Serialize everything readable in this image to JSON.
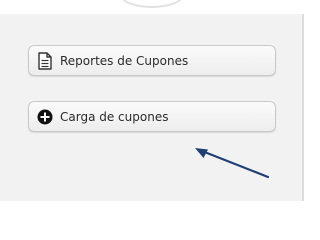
{
  "menu": {
    "items": [
      {
        "label": "Reportes de Cupones",
        "icon": "document-icon"
      },
      {
        "label": "Carga de cupones",
        "icon": "plus-circle-icon"
      }
    ]
  },
  "colors": {
    "panel_background": "#f2f2f2",
    "button_text": "#2b2b2b",
    "annotation_arrow": "#1f3f74"
  }
}
